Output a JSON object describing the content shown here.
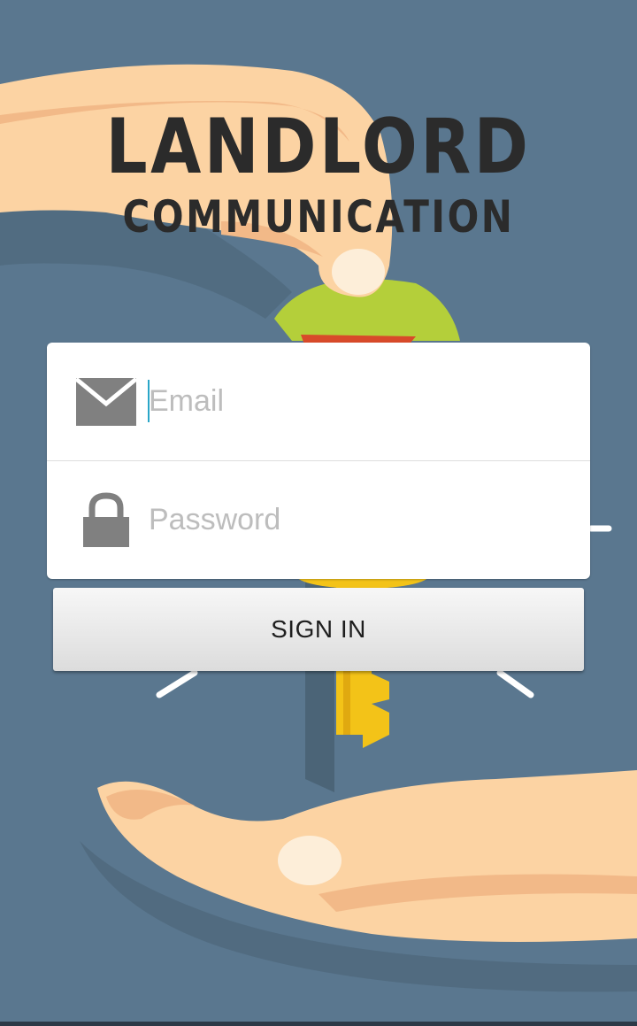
{
  "app": {
    "logo_line1": "LANDLORD",
    "logo_line2": "COMMUNICATION"
  },
  "form": {
    "email_placeholder": "Email",
    "password_placeholder": "Password",
    "email_icon": "envelope-icon",
    "password_icon": "lock-icon"
  },
  "actions": {
    "sign_in_label": "SIGN IN"
  },
  "colors": {
    "background": "#5a778f",
    "skin": "#fcd3a3",
    "key_yellow": "#f3c318",
    "tag_green": "#b4cf3a",
    "icon_gray": "#808080",
    "cursor": "#2aa6c8"
  }
}
